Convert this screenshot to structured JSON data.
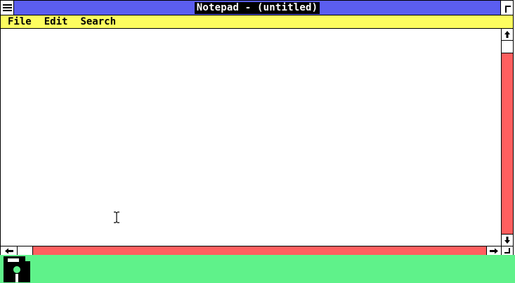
{
  "window": {
    "title": "Notepad - (untitled)"
  },
  "menu": {
    "items": [
      {
        "label": "File"
      },
      {
        "label": "Edit"
      },
      {
        "label": "Search"
      }
    ]
  },
  "colors": {
    "title_bar": "#5b5ef0",
    "menu_bar": "#fdfd5f",
    "scrollbar_track": "#ff5f5f",
    "desktop": "#5ff28a",
    "window_bg": "#ffffff",
    "frame": "#000000"
  },
  "icons": {
    "system_menu": "system-menu-icon",
    "maximize": "maximize-icon",
    "scroll_up": "arrow-up-icon",
    "scroll_down": "arrow-down-icon",
    "scroll_left": "arrow-left-icon",
    "scroll_right": "arrow-right-icon",
    "minimized_app": "floppy-disk-icon",
    "cursor": "i-beam-cursor-icon"
  }
}
